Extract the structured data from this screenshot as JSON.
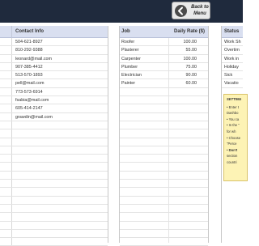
{
  "header": {
    "back_button_label": "Back to Menu"
  },
  "contacts": {
    "header": "Contact Info",
    "rows": [
      "504-621-8927",
      "810-292-9388",
      "leonard@mail.com",
      "907-385-4412",
      "513-570-1893",
      "pell@mail.com",
      "773-573-6914",
      "fsabia@mail.com",
      "605-414-2147",
      "grawdin@mail.com",
      "",
      "",
      "",
      "",
      "",
      "",
      "",
      "",
      "",
      "",
      "",
      "",
      "",
      "",
      ""
    ]
  },
  "jobs": {
    "header_job": "Job",
    "header_rate": "Daily Rate ($)",
    "rows": [
      {
        "job": "Roofer",
        "rate": "100.00"
      },
      {
        "job": "Plasterer",
        "rate": "55.00"
      },
      {
        "job": "Carpenter",
        "rate": "100.00"
      },
      {
        "job": "Plumber",
        "rate": "75.00"
      },
      {
        "job": "Electrician",
        "rate": "90.00"
      },
      {
        "job": "Painter",
        "rate": "60.00"
      },
      {
        "job": "",
        "rate": ""
      },
      {
        "job": "",
        "rate": ""
      },
      {
        "job": "",
        "rate": ""
      },
      {
        "job": "",
        "rate": ""
      },
      {
        "job": "",
        "rate": ""
      },
      {
        "job": "",
        "rate": ""
      },
      {
        "job": "",
        "rate": ""
      },
      {
        "job": "",
        "rate": ""
      },
      {
        "job": "",
        "rate": ""
      },
      {
        "job": "",
        "rate": ""
      },
      {
        "job": "",
        "rate": ""
      },
      {
        "job": "",
        "rate": ""
      },
      {
        "job": "",
        "rate": ""
      },
      {
        "job": "",
        "rate": ""
      },
      {
        "job": "",
        "rate": ""
      },
      {
        "job": "",
        "rate": ""
      },
      {
        "job": "",
        "rate": ""
      },
      {
        "job": "",
        "rate": ""
      },
      {
        "job": "",
        "rate": ""
      }
    ]
  },
  "status": {
    "header": "Status",
    "rows": [
      "Work Sh",
      "Overtim",
      "Work in",
      "Holiday",
      "Sick",
      "Vacatio"
    ]
  },
  "settings_note": {
    "title": "SETTING",
    "items": [
      {
        "bullet": "•",
        "text": "Enter t",
        "bold": false
      },
      {
        "bullet": "",
        "text": "Dashbo",
        "bold": false
      },
      {
        "bullet": "•",
        "text": "You ca",
        "bold": false
      },
      {
        "bullet": "•",
        "text": "In the \"",
        "bold": false
      },
      {
        "bullet": "",
        "text": "for wh",
        "bold": false
      },
      {
        "bullet": "•",
        "text": "Choose",
        "bold": false
      },
      {
        "bullet": "",
        "text": "\"Perce",
        "bold": false
      },
      {
        "bullet": "•",
        "text": "Don't",
        "bold": true
      },
      {
        "bullet": "",
        "text": "section",
        "bold": false
      },
      {
        "bullet": "",
        "text": "countri",
        "bold": false
      }
    ]
  },
  "colors": {
    "topbar": "#1f2a3d",
    "panel_header": "#d9dff0",
    "note_background": "#fdf3b5"
  }
}
